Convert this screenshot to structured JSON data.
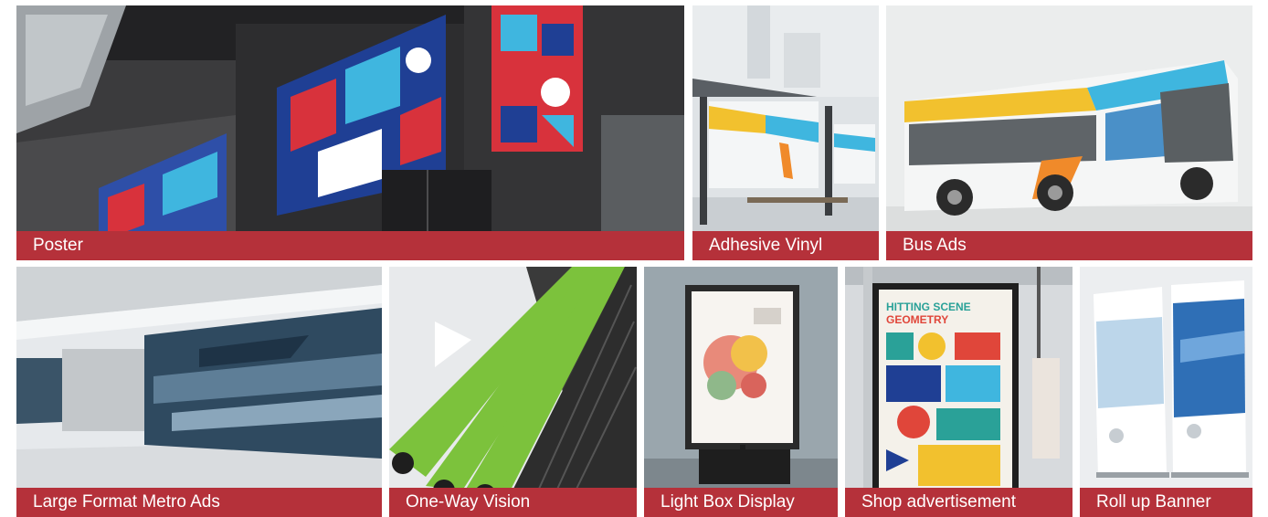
{
  "tiles": [
    {
      "id": "poster",
      "label": "Poster"
    },
    {
      "id": "adhesive-vinyl",
      "label": "Adhesive Vinyl"
    },
    {
      "id": "bus-ads",
      "label": "Bus Ads"
    },
    {
      "id": "large-format-metro-ads",
      "label": "Large Format Metro Ads"
    },
    {
      "id": "one-way-vision",
      "label": "One-Way Vision"
    },
    {
      "id": "light-box-display",
      "label": "Light Box Display"
    },
    {
      "id": "shop-advertisement",
      "label": "Shop advertisement"
    },
    {
      "id": "roll-up-banner",
      "label": "Roll up Banner"
    }
  ],
  "shop_poster_text": {
    "line1": "HITTING SCENE",
    "line2": "GEOMETRY"
  },
  "colors": {
    "caption_bg": "#b5313a",
    "caption_text": "#ffffff",
    "accent_blue": "#1f3f94",
    "accent_red": "#d8323c",
    "accent_cyan": "#3fb6df",
    "escalator_green": "#7cc23c"
  }
}
